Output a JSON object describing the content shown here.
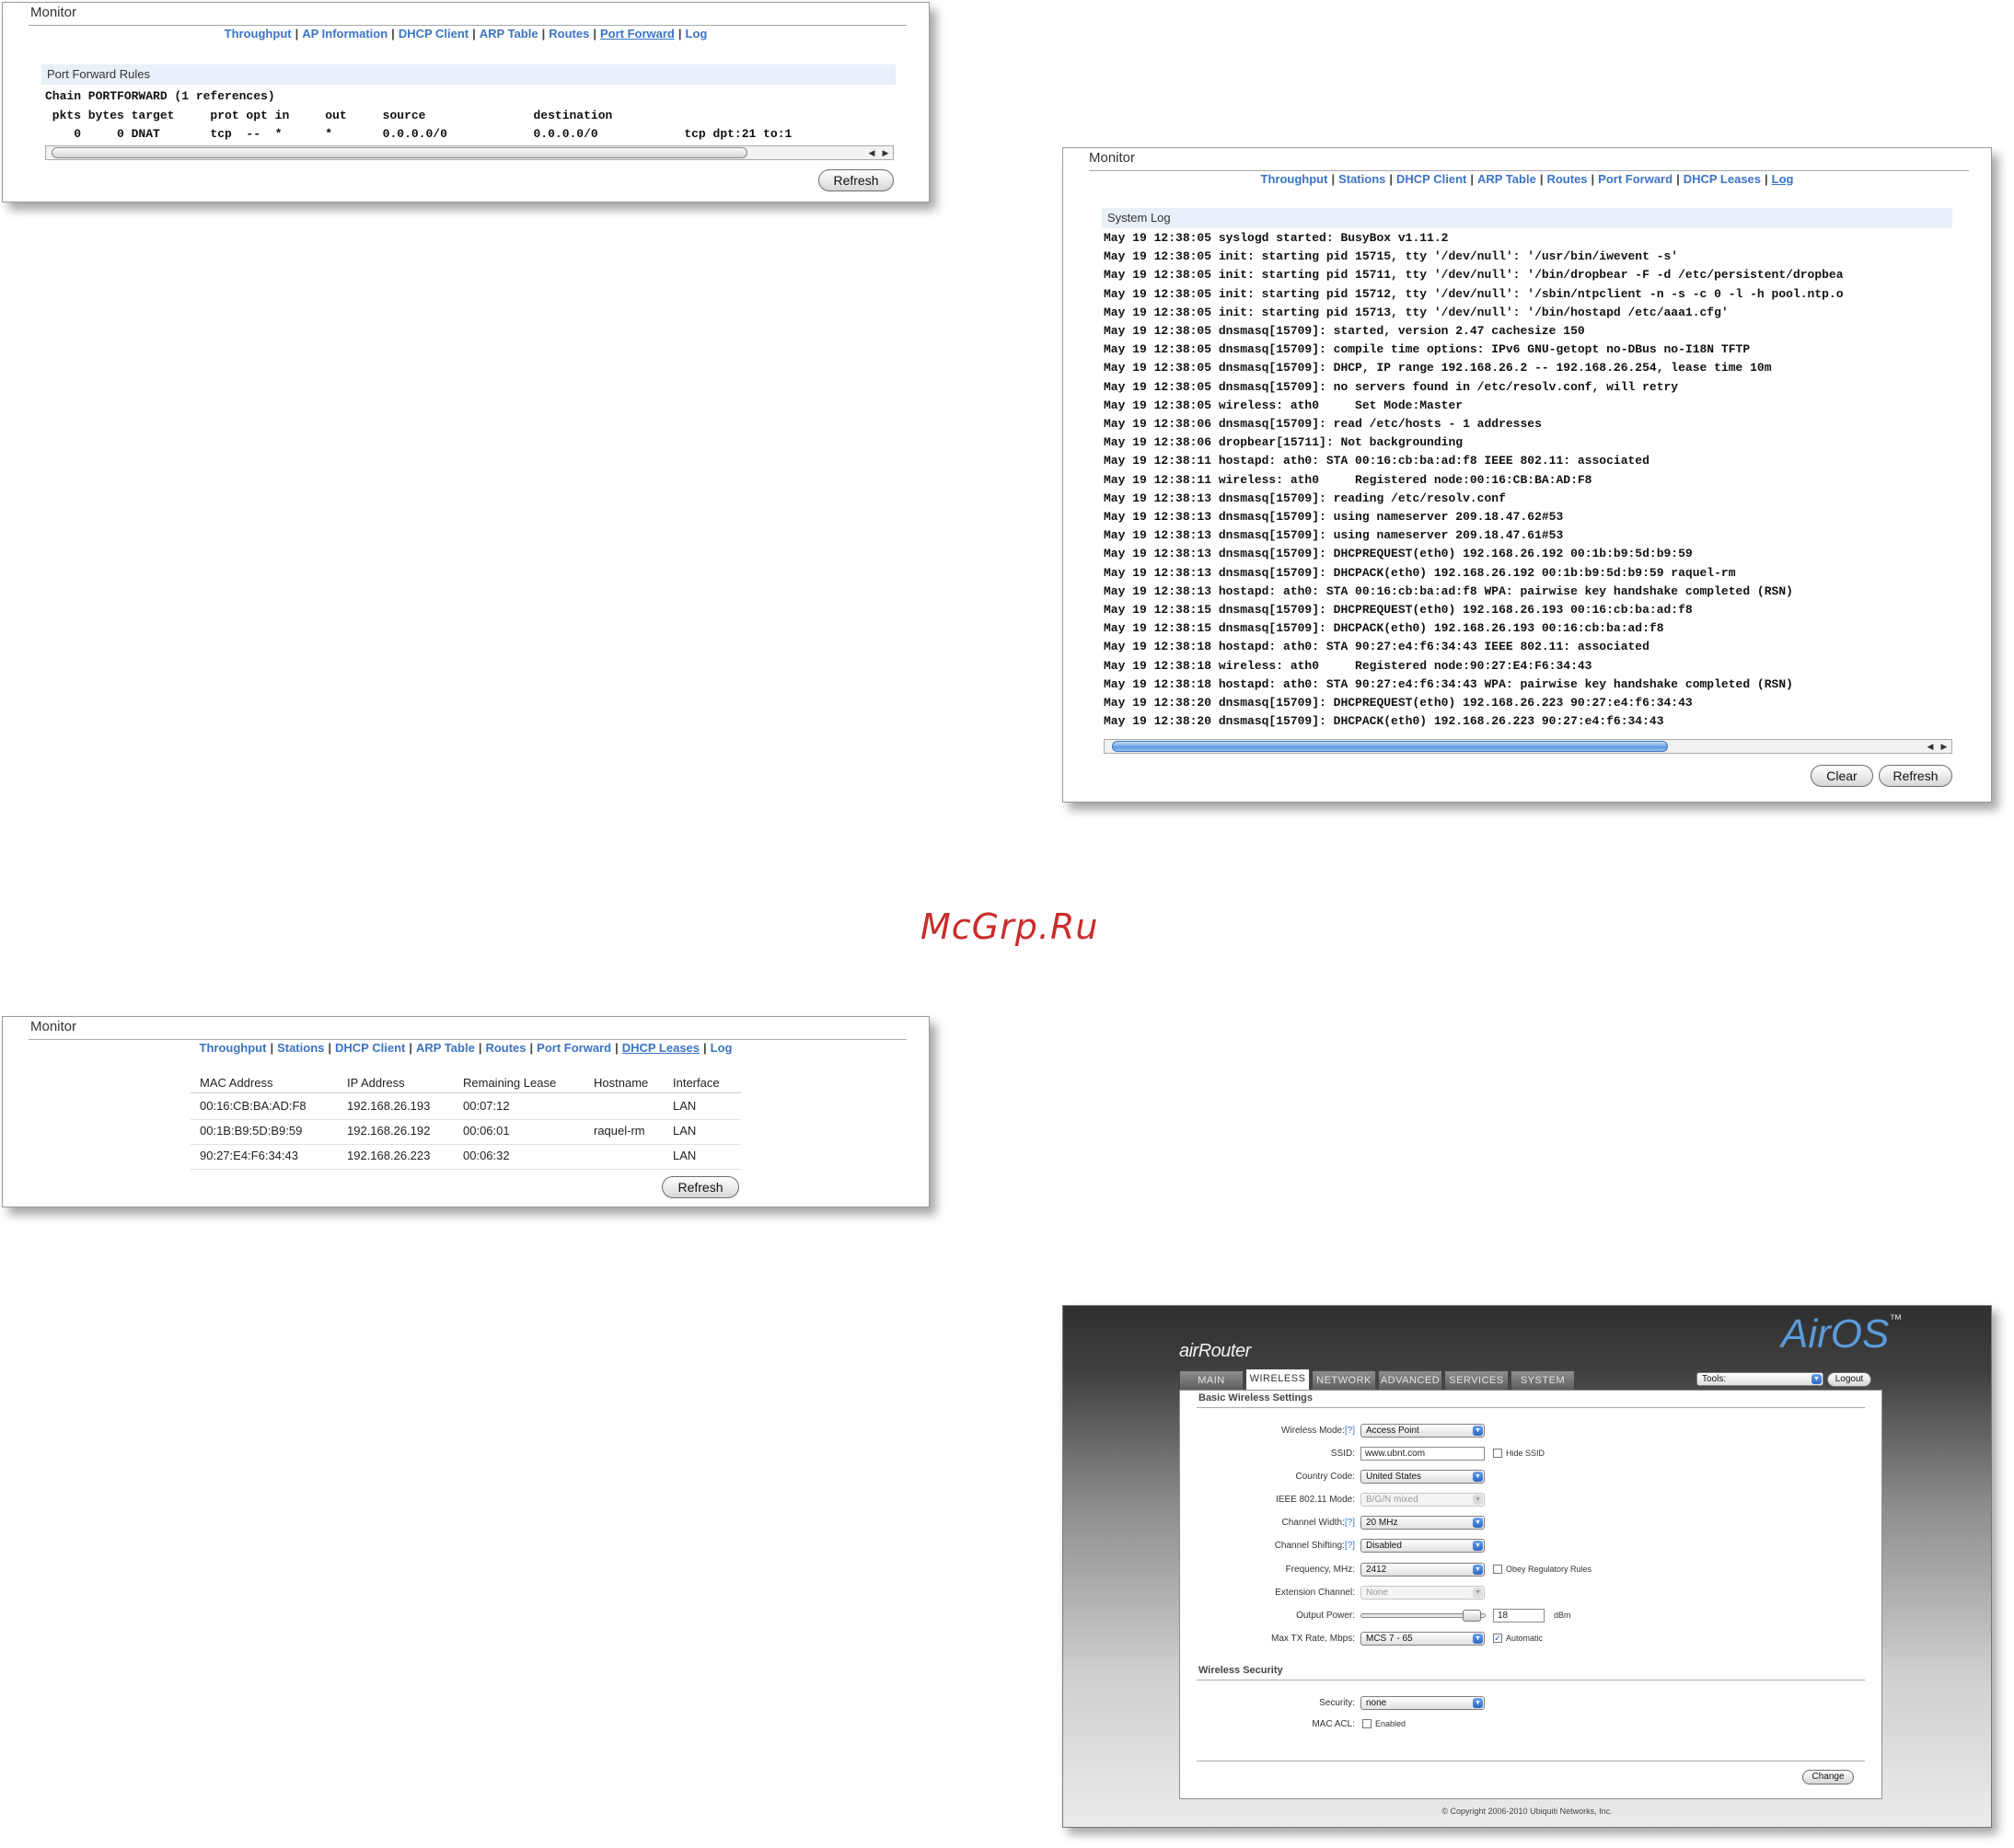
{
  "watermark": "McGrp.Ru",
  "port_forward_panel": {
    "title": "Monitor",
    "nav": [
      {
        "label": "Throughput",
        "active": false
      },
      {
        "label": "AP Information",
        "active": false
      },
      {
        "label": "DHCP Client",
        "active": false
      },
      {
        "label": "ARP Table",
        "active": false
      },
      {
        "label": "Routes",
        "active": false
      },
      {
        "label": "Port Forward",
        "active": true
      },
      {
        "label": "Log",
        "active": false
      }
    ],
    "section_title": "Port Forward Rules",
    "chain_line": "Chain PORTFORWARD (1 references)",
    "header_line": " pkts bytes target     prot opt in     out     source               destination",
    "rule_line": "    0     0 DNAT       tcp  --  *      *       0.0.0.0/0            0.0.0.0/0            tcp dpt:21 to:1",
    "refresh_label": "Refresh"
  },
  "system_log_panel": {
    "title": "Monitor",
    "nav": [
      {
        "label": "Throughput",
        "active": false
      },
      {
        "label": "Stations",
        "active": false
      },
      {
        "label": "DHCP Client",
        "active": false
      },
      {
        "label": "ARP Table",
        "active": false
      },
      {
        "label": "Routes",
        "active": false
      },
      {
        "label": "Port Forward",
        "active": false
      },
      {
        "label": "DHCP Leases",
        "active": false
      },
      {
        "label": "Log",
        "active": true
      }
    ],
    "section_title": "System Log",
    "lines": [
      "May 19 12:38:05 syslogd started: BusyBox v1.11.2",
      "May 19 12:38:05 init: starting pid 15715, tty '/dev/null': '/usr/bin/iwevent -s'",
      "May 19 12:38:05 init: starting pid 15711, tty '/dev/null': '/bin/dropbear -F -d /etc/persistent/dropbea",
      "May 19 12:38:05 init: starting pid 15712, tty '/dev/null': '/sbin/ntpclient -n -s -c 0 -l -h pool.ntp.o",
      "May 19 12:38:05 init: starting pid 15713, tty '/dev/null': '/bin/hostapd /etc/aaa1.cfg'",
      "May 19 12:38:05 dnsmasq[15709]: started, version 2.47 cachesize 150",
      "May 19 12:38:05 dnsmasq[15709]: compile time options: IPv6 GNU-getopt no-DBus no-I18N TFTP",
      "May 19 12:38:05 dnsmasq[15709]: DHCP, IP range 192.168.26.2 -- 192.168.26.254, lease time 10m",
      "May 19 12:38:05 dnsmasq[15709]: no servers found in /etc/resolv.conf, will retry",
      "May 19 12:38:05 wireless: ath0     Set Mode:Master",
      "May 19 12:38:06 dnsmasq[15709]: read /etc/hosts - 1 addresses",
      "May 19 12:38:06 dropbear[15711]: Not backgrounding",
      "May 19 12:38:11 hostapd: ath0: STA 00:16:cb:ba:ad:f8 IEEE 802.11: associated",
      "May 19 12:38:11 wireless: ath0     Registered node:00:16:CB:BA:AD:F8",
      "May 19 12:38:13 dnsmasq[15709]: reading /etc/resolv.conf",
      "May 19 12:38:13 dnsmasq[15709]: using nameserver 209.18.47.62#53",
      "May 19 12:38:13 dnsmasq[15709]: using nameserver 209.18.47.61#53",
      "May 19 12:38:13 dnsmasq[15709]: DHCPREQUEST(eth0) 192.168.26.192 00:1b:b9:5d:b9:59",
      "May 19 12:38:13 dnsmasq[15709]: DHCPACK(eth0) 192.168.26.192 00:1b:b9:5d:b9:59 raquel-rm",
      "May 19 12:38:13 hostapd: ath0: STA 00:16:cb:ba:ad:f8 WPA: pairwise key handshake completed (RSN)",
      "May 19 12:38:15 dnsmasq[15709]: DHCPREQUEST(eth0) 192.168.26.193 00:16:cb:ba:ad:f8",
      "May 19 12:38:15 dnsmasq[15709]: DHCPACK(eth0) 192.168.26.193 00:16:cb:ba:ad:f8",
      "May 19 12:38:18 hostapd: ath0: STA 90:27:e4:f6:34:43 IEEE 802.11: associated",
      "May 19 12:38:18 wireless: ath0     Registered node:90:27:E4:F6:34:43",
      "May 19 12:38:18 hostapd: ath0: STA 90:27:e4:f6:34:43 WPA: pairwise key handshake completed (RSN)",
      "May 19 12:38:20 dnsmasq[15709]: DHCPREQUEST(eth0) 192.168.26.223 90:27:e4:f6:34:43",
      "May 19 12:38:20 dnsmasq[15709]: DHCPACK(eth0) 192.168.26.223 90:27:e4:f6:34:43"
    ],
    "clear_label": "Clear",
    "refresh_label": "Refresh"
  },
  "dhcp_leases_panel": {
    "title": "Monitor",
    "nav": [
      {
        "label": "Throughput",
        "active": false
      },
      {
        "label": "Stations",
        "active": false
      },
      {
        "label": "DHCP Client",
        "active": false
      },
      {
        "label": "ARP Table",
        "active": false
      },
      {
        "label": "Routes",
        "active": false
      },
      {
        "label": "Port Forward",
        "active": false
      },
      {
        "label": "DHCP Leases",
        "active": true
      },
      {
        "label": "Log",
        "active": false
      }
    ],
    "columns": [
      "MAC Address",
      "IP Address",
      "Remaining Lease",
      "Hostname",
      "Interface"
    ],
    "rows": [
      [
        "00:16:CB:BA:AD:F8",
        "192.168.26.193",
        "00:07:12",
        "",
        "LAN"
      ],
      [
        "00:1B:B9:5D:B9:59",
        "192.168.26.192",
        "00:06:01",
        "raquel-rm",
        "LAN"
      ],
      [
        "90:27:E4:F6:34:43",
        "192.168.26.223",
        "00:06:32",
        "",
        "LAN"
      ]
    ],
    "refresh_label": "Refresh"
  },
  "airos_panel": {
    "product": "airRouter",
    "brand": "AirOS",
    "brand_tm": "™",
    "tabs": [
      {
        "label": "MAIN",
        "active": false
      },
      {
        "label": "WIRELESS",
        "active": true
      },
      {
        "label": "NETWORK",
        "active": false
      },
      {
        "label": "ADVANCED",
        "active": false
      },
      {
        "label": "SERVICES",
        "active": false
      },
      {
        "label": "SYSTEM",
        "active": false
      }
    ],
    "tools_label": "Tools:",
    "logout_label": "Logout",
    "basic_title": "Basic Wireless Settings",
    "help_marker": "[?]",
    "fields": {
      "wireless_mode": {
        "label": "Wireless Mode:",
        "value": "Access Point"
      },
      "ssid": {
        "label": "SSID:",
        "value": "www.ubnt.com",
        "hide_label": "Hide SSID"
      },
      "country_code": {
        "label": "Country Code:",
        "value": "United States"
      },
      "ieee_mode": {
        "label": "IEEE 802.11 Mode:",
        "value": "B/G/N mixed"
      },
      "channel_width": {
        "label": "Channel Width:",
        "value": "20 MHz"
      },
      "channel_shifting": {
        "label": "Channel Shifting:",
        "value": "Disabled"
      },
      "frequency": {
        "label": "Frequency, MHz:",
        "value": "2412",
        "obey_label": "Obey Regulatory Rules"
      },
      "extension_channel": {
        "label": "Extension Channel:",
        "value": "None"
      },
      "output_power": {
        "label": "Output Power:",
        "value": "18",
        "unit": "dBm",
        "slider_fraction": 0.95
      },
      "max_tx_rate": {
        "label": "Max TX Rate, Mbps:",
        "value": "MCS 7 - 65",
        "auto_label": "Automatic"
      }
    },
    "security_title": "Wireless Security",
    "security": {
      "label": "Security:",
      "value": "none"
    },
    "mac_acl": {
      "label": "MAC ACL:",
      "enabled_label": "Enabled"
    },
    "change_label": "Change",
    "copyright": "© Copyright 2006-2010 Ubiquiti Networks, Inc."
  }
}
